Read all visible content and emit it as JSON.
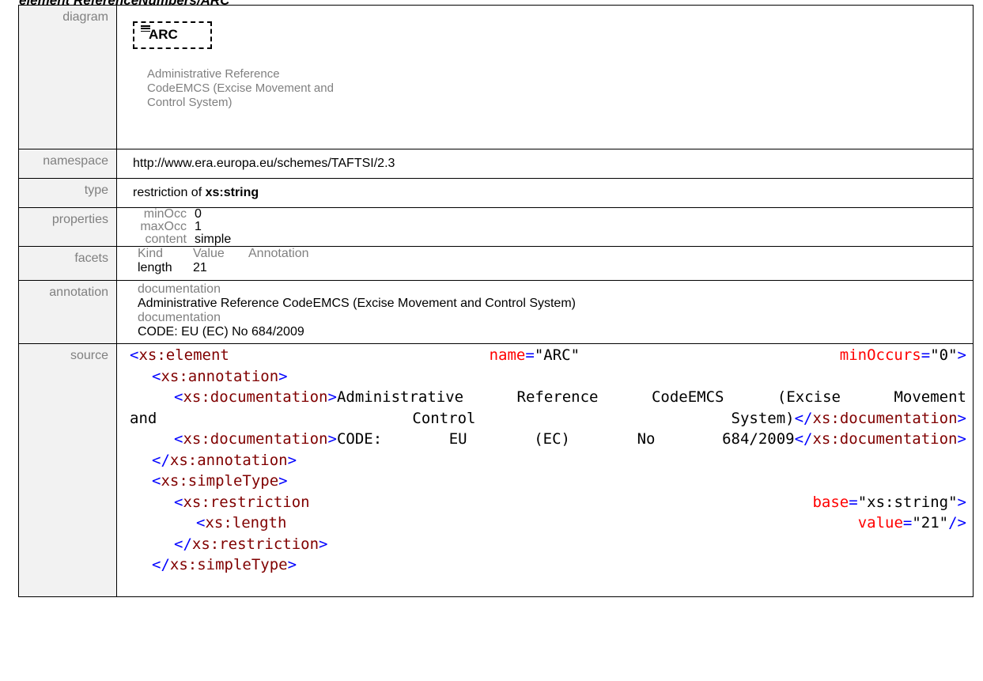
{
  "page": {
    "heading": "element ReferenceNumbers/ARC"
  },
  "labels": {
    "diagram": "diagram",
    "namespace": "namespace",
    "type": "type",
    "properties": "properties",
    "facets": "facets",
    "annotation": "annotation",
    "source": "source"
  },
  "diagram": {
    "element_name": "ARC",
    "description": "Administrative Reference CodeEMCS (Excise Movement and Control System)"
  },
  "namespace": "http://www.era.europa.eu/schemes/TAFTSI/2.3",
  "type": {
    "prefix": "restriction of ",
    "base": "xs:string"
  },
  "properties": [
    {
      "key": "minOcc",
      "value": "0"
    },
    {
      "key": "maxOcc",
      "value": "1"
    },
    {
      "key": "content",
      "value": "simple"
    }
  ],
  "facets": {
    "headers": [
      "Kind",
      "Value",
      "Annotation"
    ],
    "rows": [
      {
        "kind": "length",
        "value": "21",
        "annotation": ""
      }
    ]
  },
  "annotation": [
    {
      "label": "documentation",
      "text": "Administrative Reference CodeEMCS (Excise Movement and Control System)"
    },
    {
      "label": "documentation",
      "text": "CODE: EU (EC) No 684/2009"
    }
  ],
  "source": {
    "el_open": "xs:element",
    "name_attr": "name",
    "name_val": "\"ARC\"",
    "minocc_attr": "minOccurs",
    "minocc_val": "\"0\"",
    "annotation_tag": "xs:annotation",
    "doc_tag": "xs:documentation",
    "doc1_words": [
      "Administrative",
      "Reference",
      "CodeEMCS",
      "(Excise",
      "Movement"
    ],
    "doc1_line2": [
      "and",
      "Control",
      "System)"
    ],
    "doc2_words": [
      "CODE:",
      "EU",
      "(EC)",
      "No",
      "684/2009"
    ],
    "simpletype_tag": "xs:simpleType",
    "restriction_tag": "xs:restriction",
    "base_attr": "base",
    "base_val": "\"xs:string\"",
    "length_tag": "xs:length",
    "value_attr": "value",
    "value_val": "\"21\""
  }
}
